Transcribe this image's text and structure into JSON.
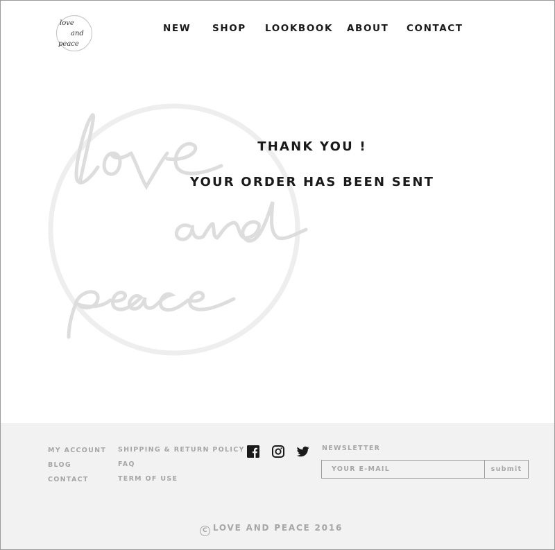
{
  "header": {
    "logo_text": "love and peace",
    "nav": [
      "NEW",
      "SHOP",
      "LOOKBOOK",
      "ABOUT",
      "CONTACT"
    ]
  },
  "main": {
    "title": "THANK YOU !",
    "subtitle": "YOUR ORDER HAS BEEN SENT",
    "watermark_text": "love and peace"
  },
  "footer": {
    "links_col1": [
      "MY ACCOUNT",
      "BLOG",
      "CONTACT"
    ],
    "links_col2": [
      "SHIPPING & RETURN POLICY",
      "FAQ",
      "TERM OF USE"
    ],
    "social_icons": [
      "facebook-icon",
      "instagram-icon",
      "twitter-icon"
    ],
    "newsletter": {
      "title": "NEWSLETTER",
      "placeholder": "YOUR E-MAIL",
      "button_label": "submit"
    },
    "copyright_symbol": "C",
    "copyright": "LOVE AND PEACE 2016"
  },
  "colors": {
    "text": "#1a1a1a",
    "footer_bg": "#f2f2f2",
    "footer_text": "#a6a6a6",
    "watermark": "#e0e0e0"
  }
}
